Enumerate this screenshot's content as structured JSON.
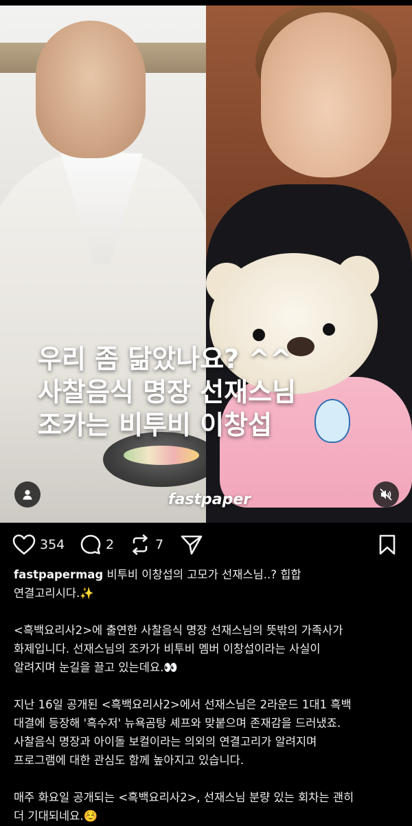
{
  "post": {
    "headline": {
      "line1": "우리 좀 닮았나요? ^^",
      "line2": "사찰음식 명장 선재스님",
      "line3": "조카는 비투비 이창섭"
    },
    "watermark": "fastpaper"
  },
  "actions": {
    "likes": "354",
    "comments": "2",
    "reposts": "7"
  },
  "caption": {
    "username": "fastpapermag",
    "line1": "비투비 이창섭의 고모가 선재스님..? 힙합",
    "line2": "연결고리시다.✨",
    "p2_line1": "<흑백요리사2>에 출연한 사찰음식 명장 선재스님의 뜻밖의 가족사가",
    "p2_line2": "화제입니다. 선재스님의 조카가 비투비 멤버 이창섭이라는 사실이",
    "p2_line3": "알려지며 눈길을 끌고 있는데요.👀",
    "p3_line1": "지난 16일 공개된 <흑백요리사2>에서 선재스님은 2라운드 1대1 흑백",
    "p3_line2": "대결에 등장해 '흑수저' 뉴욕곰탕 셰프와 맞붙으며 존재감을 드러냈죠.",
    "p3_line3": "사찰음식 명장과 아이돌 보컬이라는 의외의 연결고리가 알려지며",
    "p3_line4": "프로그램에 대한 관심도 함께 높아지고 있습니다.",
    "p4_line1": "매주 화요일 공개되는 <흑백요리사2>, 선재스님 분량 있는 회차는 괜히",
    "p4_line2": "더 기대되네요.☺️"
  },
  "icons": {
    "like": "heart-icon",
    "comment": "comment-bubble-icon",
    "repost": "repost-icon",
    "share": "send-icon",
    "save": "bookmark-icon",
    "user": "user-icon",
    "mute": "muted-speaker-icon"
  },
  "colors": {
    "background": "#000000",
    "text": "#f5f5f5"
  }
}
